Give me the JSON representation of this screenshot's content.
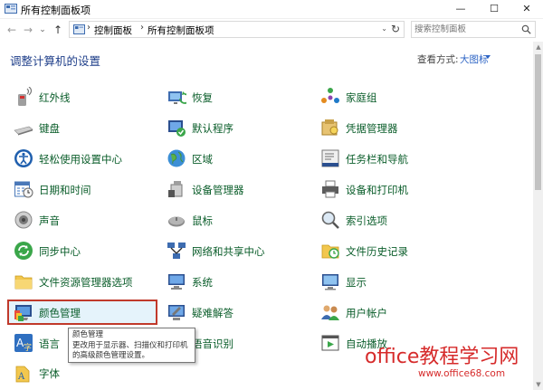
{
  "window": {
    "title": "所有控制面板项",
    "minimize_glyph": "—",
    "maximize_glyph": "☐",
    "close_glyph": "✕"
  },
  "navigation": {
    "back_glyph": "←",
    "forward_glyph": "→",
    "recent_glyph": "⌄",
    "up_glyph": "↑",
    "breadcrumb": [
      "控制面板",
      "所有控制面板项"
    ],
    "breadcrumb_separator": "›",
    "dropdown_glyph": "⌄",
    "refresh_glyph": "↻"
  },
  "search": {
    "placeholder": "搜索控制面板"
  },
  "header": {
    "heading": "调整计算机的设置",
    "view_by_label": "查看方式:",
    "view_by_value": "大图标"
  },
  "items": {
    "col1": [
      "红外线",
      "键盘",
      "轻松使用设置中心",
      "日期和时间",
      "声音",
      "同步中心",
      "文件资源管理器选项",
      "颜色管理",
      "语言",
      "字体"
    ],
    "col2": [
      "恢复",
      "默认程序",
      "区域",
      "设备管理器",
      "鼠标",
      "网络和共享中心",
      "系统",
      "疑难解答",
      "语音识别"
    ],
    "col3": [
      "家庭组",
      "凭据管理器",
      "任务栏和导航",
      "设备和打印机",
      "索引选项",
      "文件历史记录",
      "显示",
      "用户帐户",
      "自动播放"
    ]
  },
  "selected_item": "颜色管理",
  "tooltip": {
    "title": "颜色管理",
    "description": "更改用于显示器、扫描仪和打印机的高级颜色管理设置。"
  },
  "watermark": {
    "main": "office教程学习网",
    "url": "www.office68.com"
  },
  "icons": {
    "infrared": "infrared-icon",
    "recovery": "recovery-icon",
    "homegroup": "homegroup-icon",
    "keyboard": "keyboard-icon",
    "default-programs": "default-programs-icon",
    "credential": "credential-manager-icon",
    "ease-of-access": "ease-of-access-icon",
    "region": "region-globe-icon",
    "taskbar": "taskbar-icon",
    "datetime": "calendar-clock-icon",
    "device-manager": "device-manager-icon",
    "printers": "printer-icon",
    "sound": "speaker-icon",
    "mouse": "mouse-icon",
    "indexing": "indexing-magnifier-icon",
    "sync": "sync-icon",
    "network": "network-icon",
    "file-history": "file-history-icon",
    "explorer-options": "folder-options-icon",
    "system": "system-monitor-icon",
    "display": "display-icon",
    "color": "color-management-icon",
    "troubleshoot": "troubleshooting-icon",
    "accounts": "user-accounts-icon",
    "language": "language-icon",
    "speech": "speech-recognition-icon",
    "autoplay": "autoplay-icon",
    "fonts": "fonts-icon"
  }
}
